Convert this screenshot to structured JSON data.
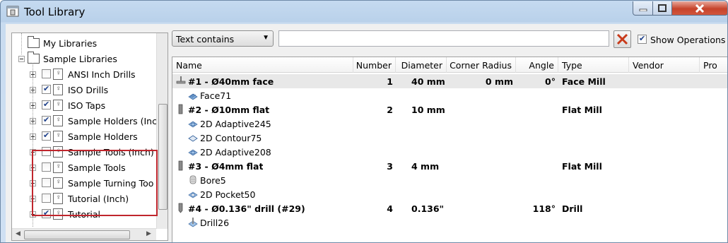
{
  "window": {
    "title": "Tool Library"
  },
  "tree": {
    "items": [
      {
        "label": "My Libraries",
        "level": 0,
        "type": "folder"
      },
      {
        "label": "Sample Libraries",
        "level": 0,
        "type": "folder"
      },
      {
        "label": "ANSI Inch Drills",
        "level": 1,
        "checked": false
      },
      {
        "label": "ISO Drills",
        "level": 1,
        "checked": true
      },
      {
        "label": "ISO Taps",
        "level": 1,
        "checked": true
      },
      {
        "label": "Sample Holders (Inch",
        "level": 1,
        "checked": true
      },
      {
        "label": "Sample Holders",
        "level": 1,
        "checked": true
      },
      {
        "label": "Sample Tools (Inch)",
        "level": 1,
        "checked": false
      },
      {
        "label": "Sample Tools",
        "level": 1,
        "checked": false
      },
      {
        "label": "Sample Turning Too",
        "level": 1,
        "checked": false
      },
      {
        "label": "Tutorial (Inch)",
        "level": 1,
        "checked": false
      },
      {
        "label": "Tutorial",
        "level": 1,
        "checked": true
      }
    ]
  },
  "filter": {
    "mode": "Text contains",
    "search_value": "",
    "show_operations_label": "Show Operations",
    "show_operations_checked": true
  },
  "table": {
    "columns": [
      "Name",
      "Number",
      "Diameter",
      "Corner Radius",
      "Angle",
      "Type",
      "Vendor",
      "Pro"
    ],
    "rows": [
      {
        "kind": "tool",
        "icon": "face-mill-icon",
        "name": "#1 - Ø40mm face",
        "number": "1",
        "diameter": "40 mm",
        "corner_radius": "0 mm",
        "angle": "0°",
        "type": "Face Mill",
        "vendor": ""
      },
      {
        "kind": "op",
        "icon": "face-op-icon",
        "name": "Face71"
      },
      {
        "kind": "tool",
        "icon": "flat-mill-icon",
        "name": "#2 - Ø10mm flat",
        "number": "2",
        "diameter": "10 mm",
        "corner_radius": "",
        "angle": "",
        "type": "Flat Mill",
        "vendor": ""
      },
      {
        "kind": "op",
        "icon": "adaptive-op-icon",
        "name": "2D Adaptive245"
      },
      {
        "kind": "op",
        "icon": "contour-op-icon",
        "name": "2D Contour75"
      },
      {
        "kind": "op",
        "icon": "adaptive-op-icon",
        "name": "2D Adaptive208"
      },
      {
        "kind": "tool",
        "icon": "flat-mill-icon",
        "name": "#3 - Ø4mm flat",
        "number": "3",
        "diameter": "4 mm",
        "corner_radius": "",
        "angle": "",
        "type": "Flat Mill",
        "vendor": ""
      },
      {
        "kind": "op",
        "icon": "bore-op-icon",
        "name": "Bore5"
      },
      {
        "kind": "op",
        "icon": "pocket-op-icon",
        "name": "2D Pocket50"
      },
      {
        "kind": "tool",
        "icon": "drill-icon",
        "name": "#4 - Ø0.136\" drill (#29)",
        "number": "4",
        "diameter": "0.136\"",
        "corner_radius": "",
        "angle": "118°",
        "type": "Drill",
        "vendor": ""
      },
      {
        "kind": "op",
        "icon": "drill-op-icon",
        "name": "Drill26"
      }
    ]
  },
  "colors": {
    "highlight_box": "#c0262d",
    "clear_icon": "#c83a1a",
    "close_button": "#c6432b"
  }
}
